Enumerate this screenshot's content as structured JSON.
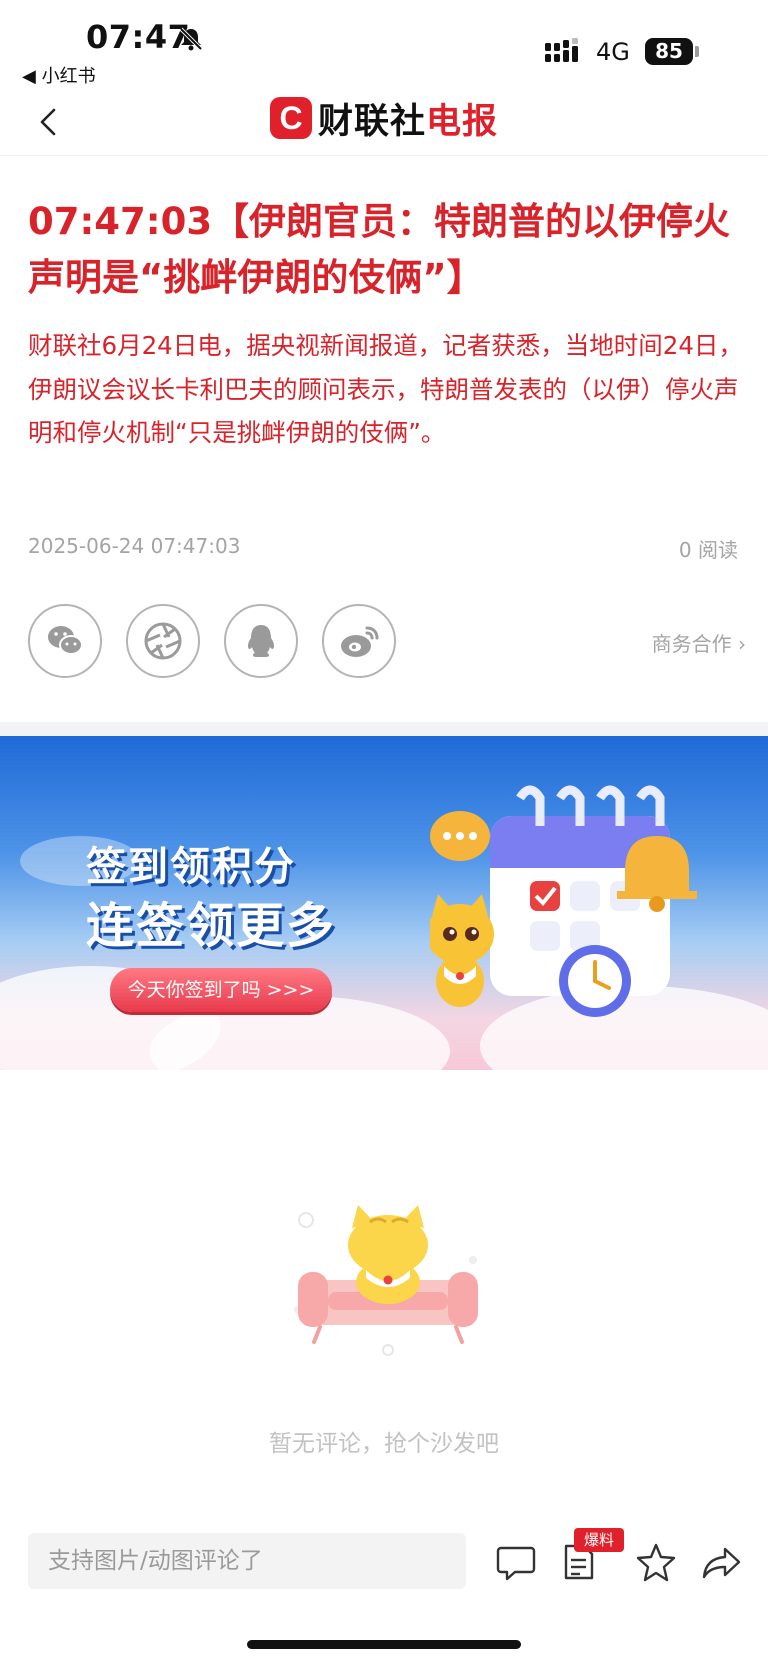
{
  "status_bar": {
    "time": "07:47",
    "back_app": "◀ 小红书",
    "network": "4G",
    "battery": "85"
  },
  "nav": {
    "brand_logo": "C",
    "brand_name": "财联社",
    "brand_tail": "电报"
  },
  "article": {
    "headline": "07:47:03【伊朗官员：特朗普的以伊停火声明是“挑衅伊朗的伎俩”】",
    "body": "财联社6月24日电，据央视新闻报道，记者获悉，当地时间24日，伊朗议会议长卡利巴夫的顾问表示，特朗普发表的（以伊）停火声明和停火机制“只是挑衅伊朗的伎俩”。",
    "datetime": "2025-06-24 07:47:03",
    "reads": "0 阅读",
    "business_link": "商务合作 ›"
  },
  "share_buttons": [
    {
      "icon": "wechat-icon"
    },
    {
      "icon": "moments-icon"
    },
    {
      "icon": "qq-icon"
    },
    {
      "icon": "weibo-icon"
    }
  ],
  "banner": {
    "line1": "签到领积分",
    "line2": "连签领更多",
    "cta": "今天你签到了吗 >>>"
  },
  "comments": {
    "empty_text": "暂无评论，抢个沙发吧"
  },
  "bottom_bar": {
    "input_placeholder": "支持图片/动图评论了",
    "tip_badge": "爆料"
  },
  "colors": {
    "accent_red": "#d8232a",
    "brand_red": "#e0202a",
    "meta_gray": "#a4a4a4"
  }
}
